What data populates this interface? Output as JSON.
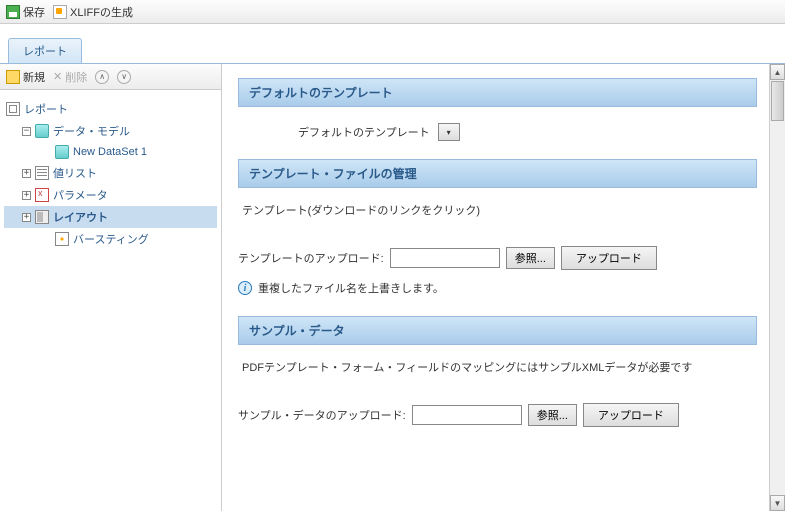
{
  "toolbar": {
    "save_label": "保存",
    "xliff_label": "XLIFFの生成"
  },
  "tabs": {
    "report": "レポート"
  },
  "sidebar_toolbar": {
    "new_label": "新規",
    "delete_label": "削除"
  },
  "tree": {
    "report": "レポート",
    "data_model": "データ・モデル",
    "new_dataset": "New DataSet 1",
    "value_list": "値リスト",
    "parameter": "パラメータ",
    "layout": "レイアウト",
    "bursting": "バースティング"
  },
  "sections": {
    "default_template": {
      "header": "デフォルトのテンプレート",
      "label": "デフォルトのテンプレート"
    },
    "template_mgmt": {
      "header": "テンプレート・ファイルの管理",
      "hint": "テンプレート(ダウンロードのリンクをクリック)",
      "upload_label": "テンプレートのアップロード:",
      "browse": "参照...",
      "upload": "アップロード",
      "info": "重複したファイル名を上書きします。"
    },
    "sample_data": {
      "header": "サンプル・データ",
      "description": "PDFテンプレート・フォーム・フィールドのマッピングにはサンプルXMLデータが必要です",
      "upload_label": "サンプル・データのアップロード:",
      "browse": "参照...",
      "upload": "アップロード"
    }
  }
}
